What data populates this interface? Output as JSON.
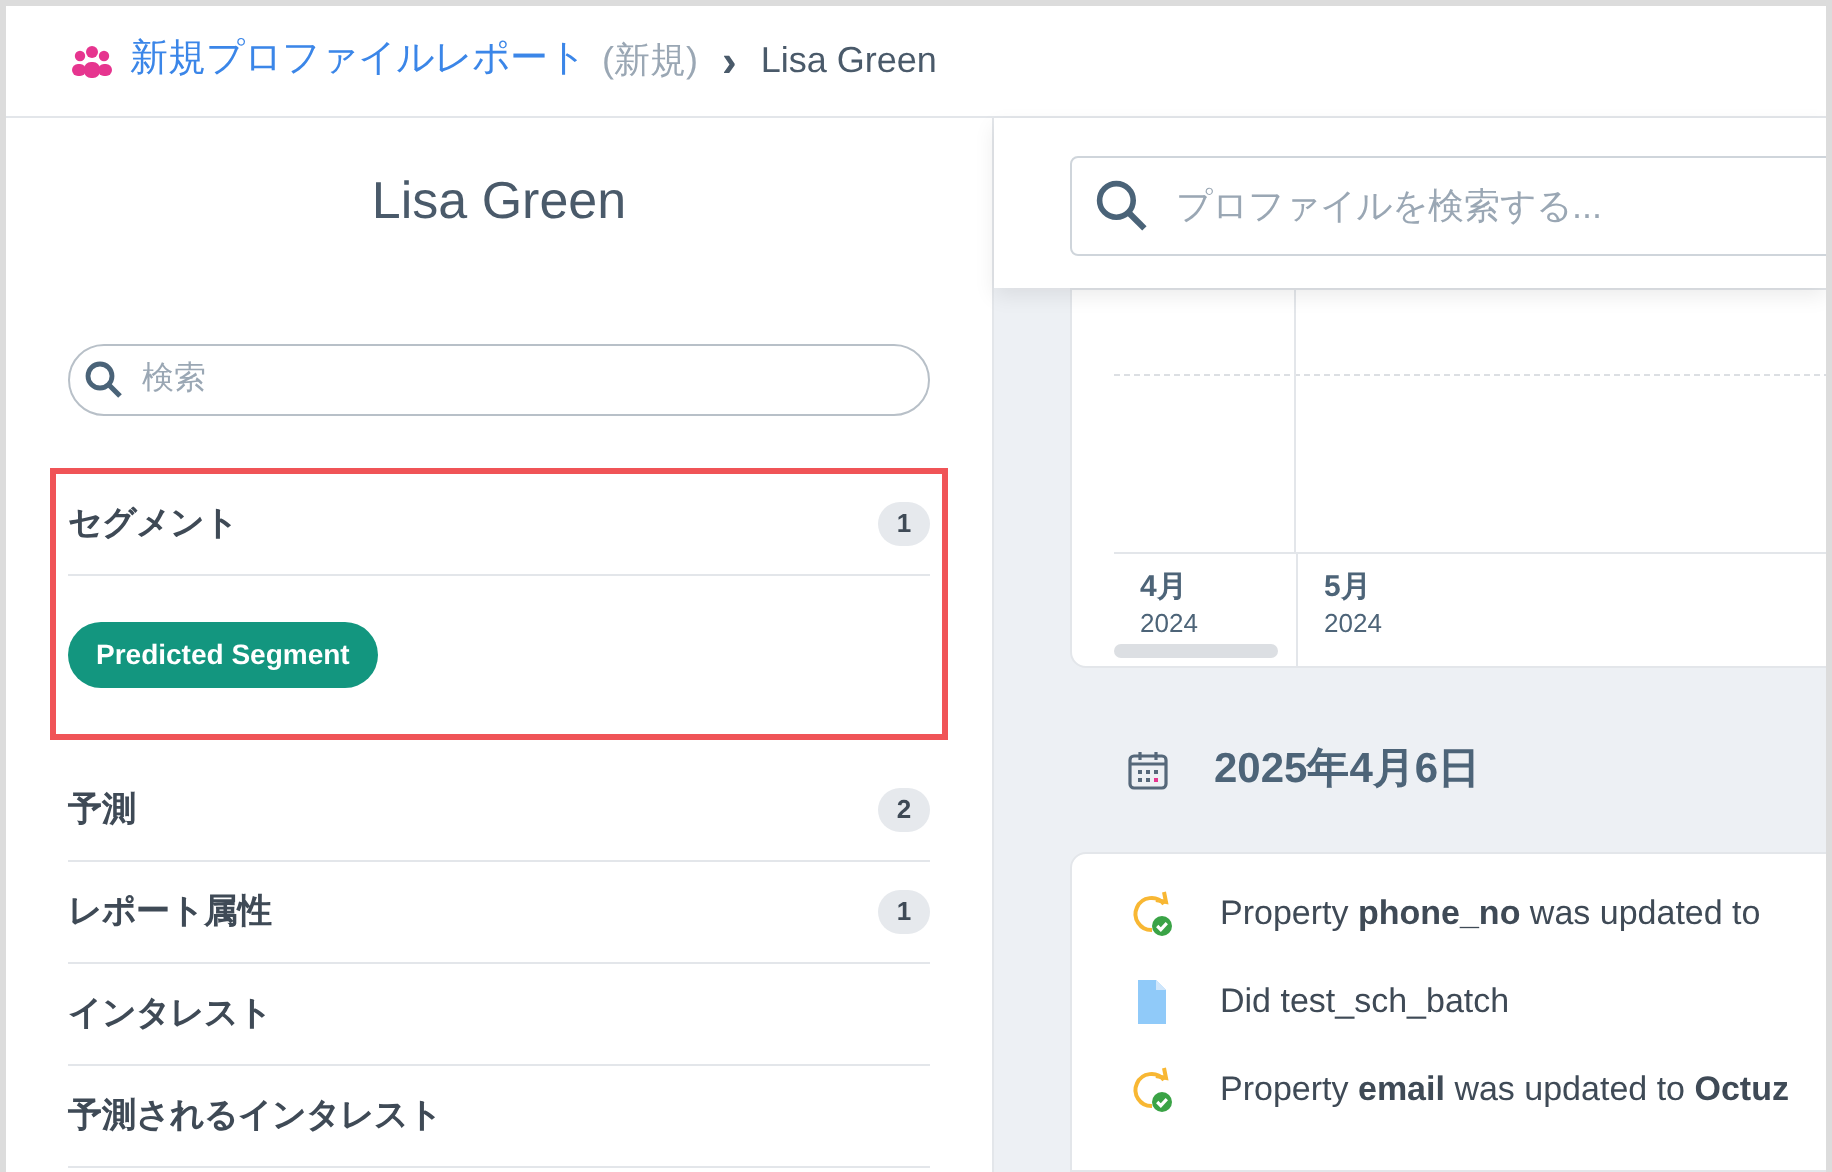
{
  "breadcrumb": {
    "parent": "新規プロファイルレポート",
    "parent_note": "(新規)",
    "separator": "›",
    "current": "Lisa Green"
  },
  "sidebar": {
    "title": "Lisa Green",
    "search": {
      "placeholder": "検索"
    },
    "sections": [
      {
        "label": "セグメント",
        "count": "1",
        "highlighted": true,
        "tags": [
          "Predicted Segment"
        ]
      },
      {
        "label": "予測",
        "count": "2",
        "highlighted": false
      },
      {
        "label": "レポート属性",
        "count": "1",
        "highlighted": false
      },
      {
        "label": "インタレスト",
        "highlighted": false
      },
      {
        "label": "予測されるインタレスト",
        "highlighted": false
      }
    ]
  },
  "profile_search": {
    "placeholder": "プロファイルを検索する..."
  },
  "timeline_axis": [
    {
      "month": "4月",
      "year": "2024"
    },
    {
      "month": "5月",
      "year": "2024"
    }
  ],
  "day": {
    "date": "2025年4月6日",
    "events": [
      {
        "kind": "update",
        "text": "Property **phone_no** was updated to"
      },
      {
        "kind": "event",
        "text": "Did test_sch_batch"
      },
      {
        "kind": "update",
        "text": "Property **email** was updated to **Octuz**"
      }
    ]
  }
}
